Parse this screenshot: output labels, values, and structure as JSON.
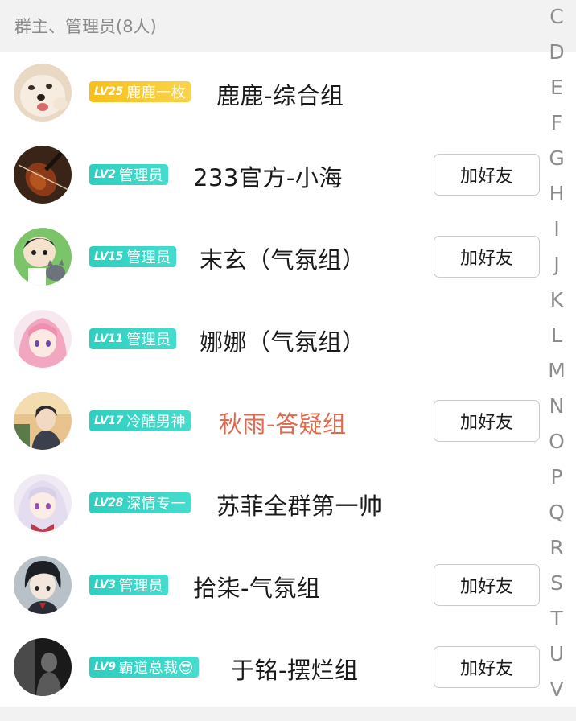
{
  "section_header": "群主、管理员(8人)",
  "add_friend_label": "加好友",
  "colors": {
    "gold_badge": "#f7c01a",
    "teal_badge": "#2ecfc0",
    "highlight_name": "#e06a4e",
    "header_bg": "#f2f2f2"
  },
  "members": [
    {
      "level": "LV25",
      "title": "鹿鹿一枚",
      "name": "鹿鹿-综合组",
      "badge": "gold",
      "has_add_button": false,
      "avatar": "dog-avatar"
    },
    {
      "level": "LV2",
      "title": "管理员",
      "name": "233官方-小海",
      "badge": "teal",
      "has_add_button": true,
      "avatar": "violin-avatar"
    },
    {
      "level": "LV15",
      "title": "管理员",
      "name": "末玄（气氛组）",
      "badge": "teal",
      "has_add_button": true,
      "avatar": "boy-cat-avatar"
    },
    {
      "level": "LV11",
      "title": "管理员",
      "name": "娜娜（气氛组）",
      "badge": "teal",
      "has_add_button": false,
      "avatar": "pink-hair-girl-avatar"
    },
    {
      "level": "LV17",
      "title": "冷酷男神",
      "name": "秋雨-答疑组",
      "badge": "teal",
      "has_add_button": true,
      "avatar": "anime-boy-avatar",
      "highlight": true
    },
    {
      "level": "LV28",
      "title": "深情专一",
      "name": "苏菲全群第一帅",
      "badge": "teal",
      "has_add_button": false,
      "avatar": "white-hair-girl-avatar"
    },
    {
      "level": "LV3",
      "title": "管理员",
      "name": "拾柒-气氛组",
      "badge": "teal",
      "has_add_button": true,
      "avatar": "dark-hair-boy-avatar"
    },
    {
      "level": "LV9",
      "title": "霸道总裁😎",
      "name": "于铭-摆烂组",
      "badge": "teal",
      "has_add_button": true,
      "avatar": "silhouette-avatar"
    }
  ],
  "index_letters": [
    "C",
    "D",
    "E",
    "F",
    "G",
    "H",
    "I",
    "J",
    "K",
    "L",
    "M",
    "N",
    "O",
    "P",
    "Q",
    "R",
    "S",
    "T",
    "U",
    "V"
  ]
}
